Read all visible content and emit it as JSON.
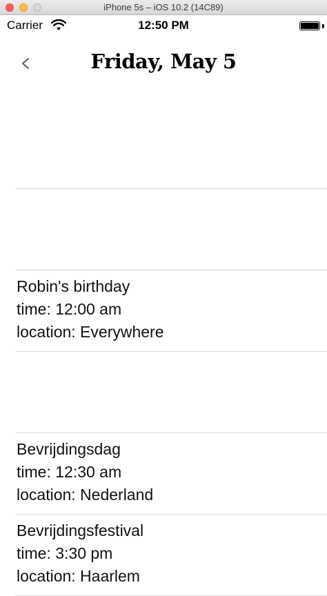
{
  "window": {
    "title": "iPhone 5s – iOS 10.2 (14C89)"
  },
  "status_bar": {
    "carrier": "Carrier",
    "time": "12:50 PM",
    "icons": [
      "wifi-icon",
      "battery-icon"
    ]
  },
  "header": {
    "back_label": "<",
    "title": "Friday, May 5"
  },
  "events": [
    {
      "title": "",
      "time": "",
      "location": ""
    },
    {
      "title": "",
      "time": "",
      "location": ""
    },
    {
      "title": "Robin's birthday",
      "time": "time: 12:00 am",
      "location": "location: Everywhere"
    },
    {
      "title": "",
      "time": "",
      "location": ""
    },
    {
      "title": "Bevrijdingsdag",
      "time": "time: 12:30 am",
      "location": "location: Nederland"
    },
    {
      "title": "Bevrijdingsfestival",
      "time": "time: 3:30 pm",
      "location": "location: Haarlem"
    }
  ]
}
